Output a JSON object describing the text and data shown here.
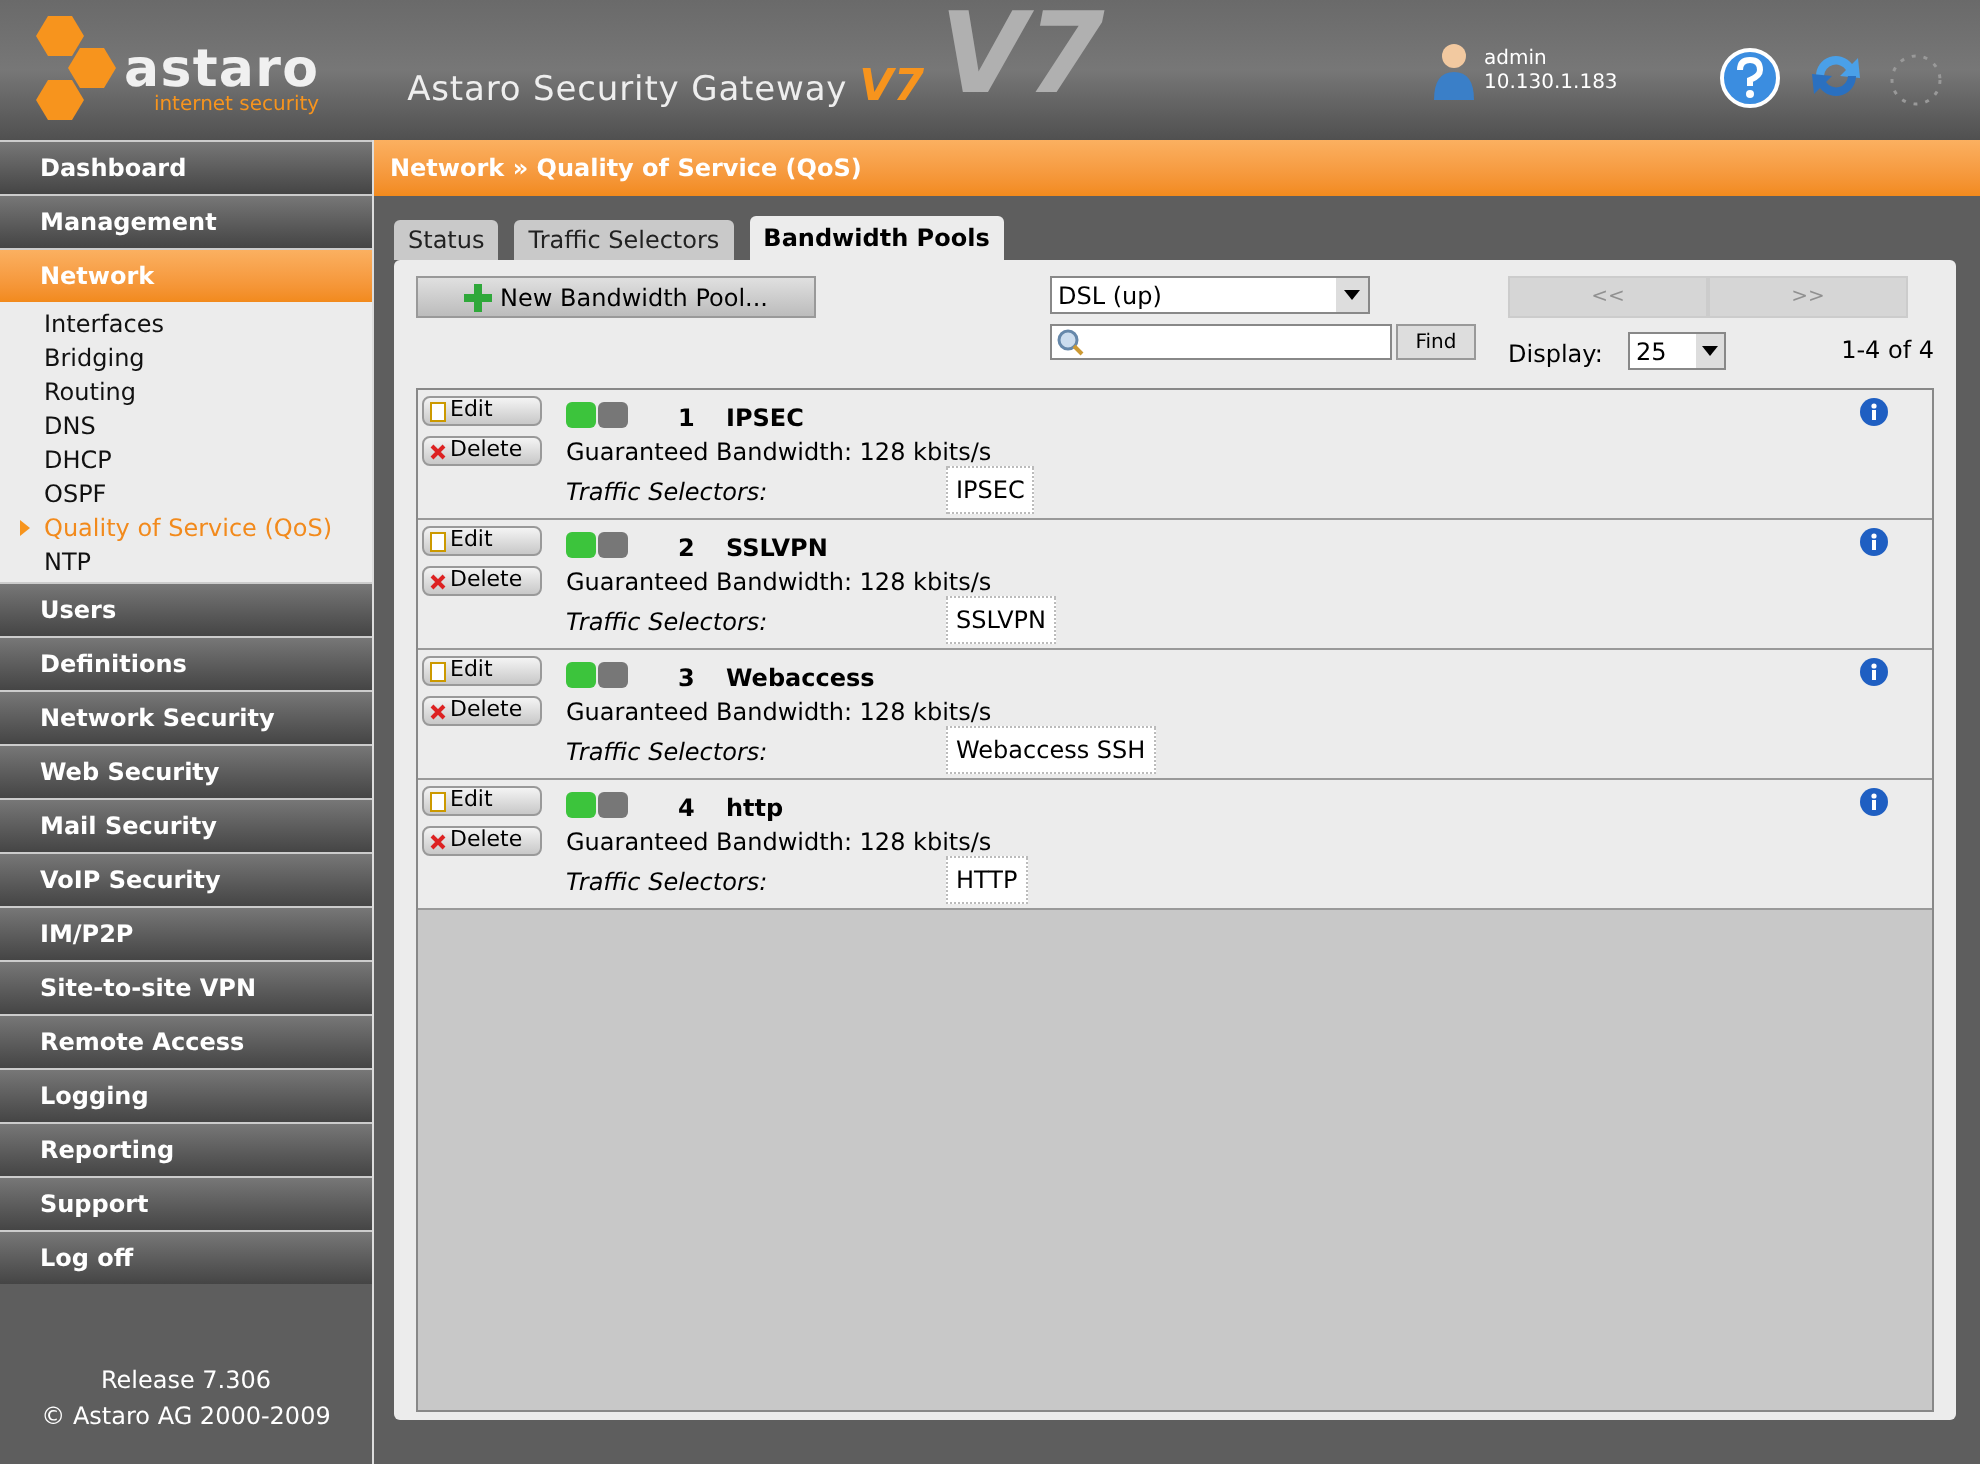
{
  "header": {
    "logo_name": "astaro",
    "logo_tagline": "internet security",
    "product": "Astaro Security Gateway",
    "version_small": "V7",
    "version_big": "V7",
    "user": "admin",
    "ip": "10.130.1.183"
  },
  "sidebar": {
    "items": [
      {
        "label": "Dashboard",
        "selected": false
      },
      {
        "label": "Management",
        "selected": false
      },
      {
        "label": "Network",
        "selected": true,
        "children": [
          {
            "label": "Interfaces",
            "selected": false
          },
          {
            "label": "Bridging",
            "selected": false
          },
          {
            "label": "Routing",
            "selected": false
          },
          {
            "label": "DNS",
            "selected": false
          },
          {
            "label": "DHCP",
            "selected": false
          },
          {
            "label": "OSPF",
            "selected": false
          },
          {
            "label": "Quality of Service (QoS)",
            "selected": true
          },
          {
            "label": "NTP",
            "selected": false
          }
        ]
      },
      {
        "label": "Users",
        "selected": false
      },
      {
        "label": "Definitions",
        "selected": false
      },
      {
        "label": "Network Security",
        "selected": false
      },
      {
        "label": "Web Security",
        "selected": false
      },
      {
        "label": "Mail Security",
        "selected": false
      },
      {
        "label": "VoIP Security",
        "selected": false
      },
      {
        "label": "IM/P2P",
        "selected": false
      },
      {
        "label": "Site-to-site VPN",
        "selected": false
      },
      {
        "label": "Remote Access",
        "selected": false
      },
      {
        "label": "Logging",
        "selected": false
      },
      {
        "label": "Reporting",
        "selected": false
      },
      {
        "label": "Support",
        "selected": false
      },
      {
        "label": "Log off",
        "selected": false
      }
    ],
    "release": "Release 7.306",
    "copyright": "© Astaro AG 2000-2009"
  },
  "breadcrumb": "Network » Quality of Service (QoS)",
  "tabs": [
    {
      "label": "Status",
      "selected": false
    },
    {
      "label": "Traffic Selectors",
      "selected": false
    },
    {
      "label": "Bandwidth Pools",
      "selected": true
    }
  ],
  "toolbar": {
    "new_button": "New Bandwidth Pool...",
    "interface": "DSL (up)",
    "find": "Find",
    "prev": "<<",
    "next": ">>",
    "display_label": "Display:",
    "display_value": "25",
    "range": "1-4 of 4"
  },
  "pools": [
    {
      "edit": "Edit",
      "delete": "Delete",
      "number": "1",
      "name": "IPSEC",
      "enabled": true,
      "bandwidth": "Guaranteed Bandwidth: 128 kbits/s",
      "selectors_label": "Traffic Selectors:",
      "selectors": "IPSEC"
    },
    {
      "edit": "Edit",
      "delete": "Delete",
      "number": "2",
      "name": "SSLVPN",
      "enabled": true,
      "bandwidth": "Guaranteed Bandwidth: 128 kbits/s",
      "selectors_label": "Traffic Selectors:",
      "selectors": "SSLVPN"
    },
    {
      "edit": "Edit",
      "delete": "Delete",
      "number": "3",
      "name": "Webaccess",
      "enabled": true,
      "bandwidth": "Guaranteed Bandwidth: 128 kbits/s",
      "selectors_label": "Traffic Selectors:",
      "selectors": "Webaccess SSH"
    },
    {
      "edit": "Edit",
      "delete": "Delete",
      "number": "4",
      "name": "http",
      "enabled": true,
      "bandwidth": "Guaranteed Bandwidth: 128 kbits/s",
      "selectors_label": "Traffic Selectors:",
      "selectors": "HTTP"
    }
  ]
}
